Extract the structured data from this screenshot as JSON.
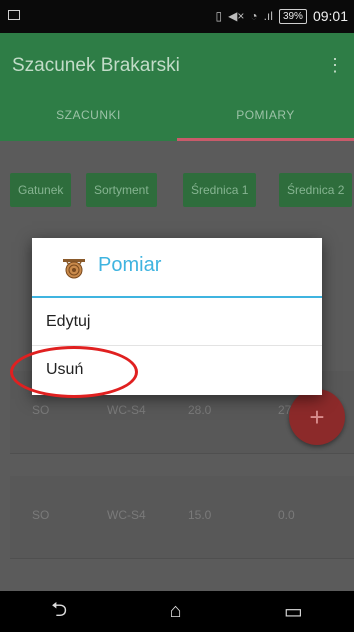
{
  "status_bar": {
    "battery": "39%",
    "time": "09:01"
  },
  "app_bar": {
    "title": "Szacunek Brakarski",
    "menu_icon": "overflow-menu-icon"
  },
  "tabs": [
    {
      "label": "SZACUNKI"
    },
    {
      "label": "POMIARY"
    }
  ],
  "chips": [
    {
      "label": "Gatunek"
    },
    {
      "label": "Sortyment"
    },
    {
      "label": "Średnica 1"
    },
    {
      "label": "Średnica 2"
    }
  ],
  "rows": [
    {
      "gatunek": "SO",
      "sortyment": "WC-S4",
      "srednica1": "28.0",
      "srednica2": "27.5"
    },
    {
      "gatunek": "SO",
      "sortyment": "WC-S4",
      "srednica1": "15.0",
      "srednica2": "0.0"
    }
  ],
  "fab": {
    "label": "+"
  },
  "dialog": {
    "title": "Pomiar",
    "icon": "tree-stump-icon",
    "items": [
      {
        "label": "Edytuj"
      },
      {
        "label": "Usuń"
      }
    ]
  },
  "colors": {
    "app_green": "#2e7d46",
    "dialog_accent": "#3fb4e0",
    "highlight": "#e02020"
  },
  "nav_bar": {
    "back_icon": "back-icon",
    "home_icon": "home-icon",
    "recents_icon": "recents-icon"
  }
}
